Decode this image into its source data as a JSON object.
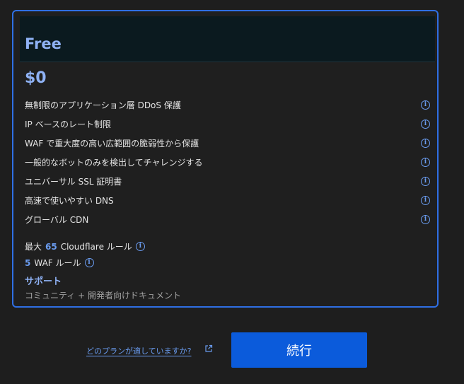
{
  "plan": {
    "name": "Free",
    "price": "$0",
    "features": [
      {
        "label": "無制限のアプリケーション層 DDoS 保護",
        "icon": "info-icon"
      },
      {
        "label": "IP ベースのレート制限",
        "icon": "info-icon"
      },
      {
        "label": "WAF で重大度の高い広範囲の脆弱性から保護",
        "icon": "info-icon"
      },
      {
        "label": "一般的なボットのみを検出してチャレンジする",
        "icon": "info-icon"
      },
      {
        "label": "ユニバーサル SSL 証明書",
        "icon": "info-icon"
      },
      {
        "label": "高速で使いやすい DNS",
        "icon": "info-icon"
      },
      {
        "label": "グローバル CDN",
        "icon": "info-icon"
      }
    ],
    "rules": {
      "cloudflare_prefix": "最大",
      "cloudflare_count": "65",
      "cloudflare_suffix": "Cloudflare ルール",
      "waf_count": "5",
      "waf_suffix": "WAF ルール"
    },
    "support": {
      "title": "サポート",
      "text": "コミュニティ + 開発者向けドキュメント"
    }
  },
  "footer": {
    "help_link": "どのプランが適していますか?",
    "continue_label": "続行"
  },
  "colors": {
    "accent": "#2f6fe4",
    "button": "#0b5bdb",
    "link": "#6a9cf0",
    "background": "#1e1e1e"
  }
}
